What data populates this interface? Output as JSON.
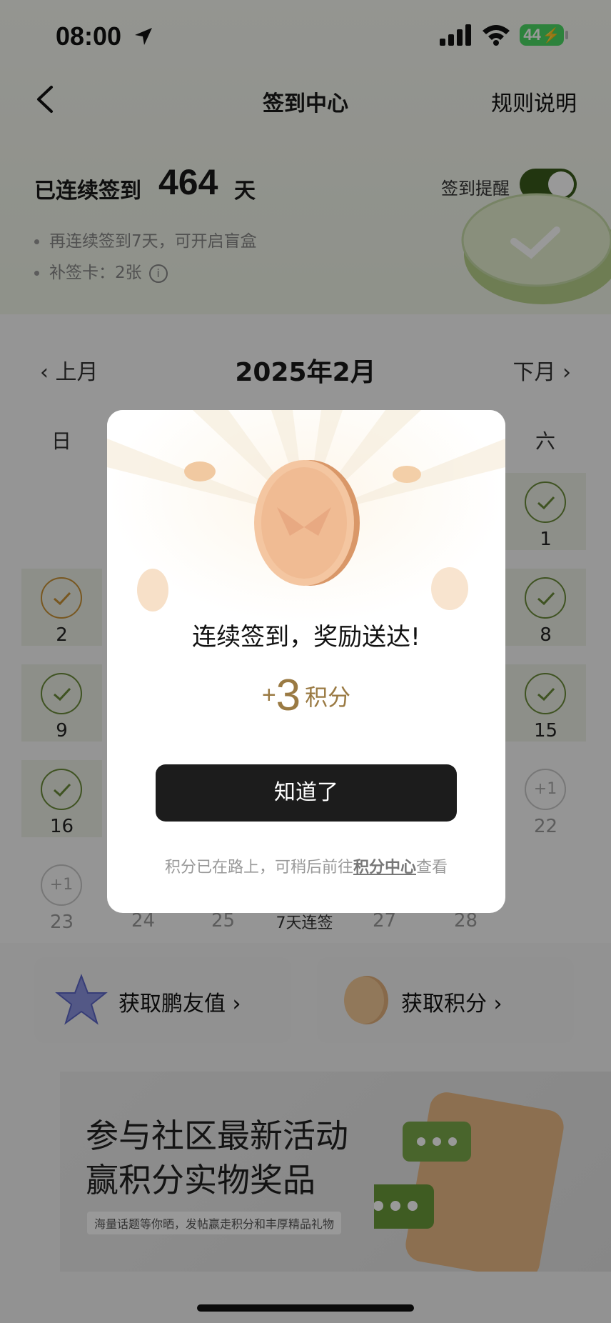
{
  "status_bar": {
    "time": "08:00",
    "battery": "44"
  },
  "nav": {
    "title": "签到中心",
    "rules": "规则说明"
  },
  "streak": {
    "label": "已连续签到",
    "days": "464",
    "unit": "天",
    "reminder_label": "签到提醒",
    "reminder_on": true,
    "hints": [
      "再连续签到7天，可开启盲盒",
      "补签卡：2张"
    ]
  },
  "calendar": {
    "title": "2025年2月",
    "prev": "上月",
    "next": "下月",
    "weekdays": [
      "日",
      "六"
    ],
    "days": {
      "d1": "1",
      "d2": "2",
      "d8": "8",
      "d9": "9",
      "d15": "15",
      "d16": "16",
      "d22": "22",
      "d23": "23",
      "d24": "24",
      "d25": "25",
      "d27": "27",
      "d28": "28"
    },
    "plus_one": "+1",
    "bonus_label": "7天连签"
  },
  "entries": {
    "friends": "获取鹏友值",
    "points": "获取积分"
  },
  "banner": {
    "line1": "参与社区最新活动",
    "line2": "赢积分实物奖品",
    "sub": "海量话题等你晒，发帖赢走积分和丰厚精品礼物"
  },
  "modal": {
    "title": "连续签到，奖励送达!",
    "plus": "+",
    "points": "3",
    "unit": "积分",
    "button": "知道了",
    "note_prefix": "积分已在路上，可稍后前往",
    "note_link": "积分中心",
    "note_suffix": "查看"
  },
  "colors": {
    "accent_green": "#6a8a3a",
    "gold": "#9a7a43",
    "button": "#1c1c1c"
  }
}
